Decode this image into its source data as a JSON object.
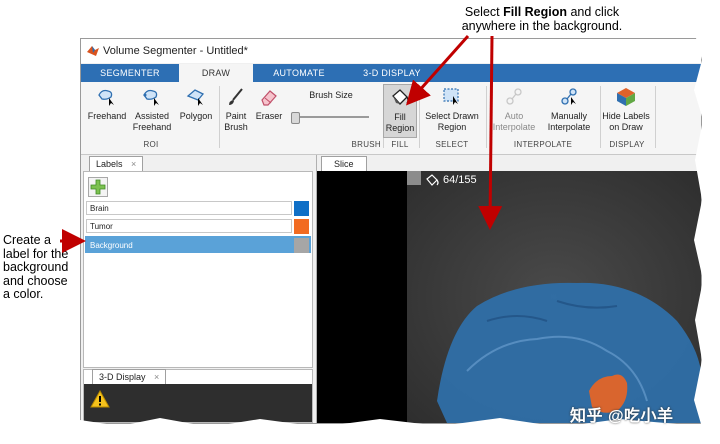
{
  "annotations": {
    "top_line1_pre": "Select ",
    "top_line1_bold": "Fill Region",
    "top_line1_post": " and click",
    "top_line2": "anywhere in the background.",
    "left_lines": [
      "Create a",
      "label for the",
      "background",
      "and choose",
      "a color."
    ]
  },
  "window": {
    "title": "Volume Segmenter - Untitled*"
  },
  "tabs": [
    {
      "label": "SEGMENTER"
    },
    {
      "label": "DRAW"
    },
    {
      "label": "AUTOMATE"
    },
    {
      "label": "3-D DISPLAY"
    }
  ],
  "ribbon": {
    "roi": {
      "freehand": "Freehand",
      "assisted_1": "Assisted",
      "assisted_2": "Freehand",
      "polygon": "Polygon",
      "group": "ROI"
    },
    "brush": {
      "paint_1": "Paint",
      "paint_2": "Brush",
      "eraser": "Eraser",
      "size_label": "Brush Size",
      "group": "BRUSH",
      "size_level": 0.0
    },
    "fill": {
      "label_1": "Fill",
      "label_2": "Region",
      "group": "FILL"
    },
    "select": {
      "label_1": "Select Drawn",
      "label_2": "Region",
      "group": "SELECT"
    },
    "interpolate": {
      "auto_1": "Auto",
      "auto_2": "Interpolate",
      "manual_1": "Manually",
      "manual_2": "Interpolate",
      "group": "INTERPOLATE"
    },
    "display": {
      "hide_1": "Hide Labels",
      "hide_2": "on Draw",
      "group": "DISPLAY"
    }
  },
  "labels_panel": {
    "tab": "Labels",
    "close": "×",
    "items": [
      {
        "name": "Brain",
        "color": "#0f6fc6"
      },
      {
        "name": "Tumor",
        "color": "#f26b21"
      },
      {
        "name": "Background",
        "color": "#a6a6a6"
      }
    ]
  },
  "slice_panel": {
    "tab": "Slice",
    "counter": "64/155"
  },
  "threed_panel": {
    "tab": "3-D Display",
    "close": "×"
  },
  "colors": {
    "tab_bar": "#2d6fb4",
    "selected_row": "#5aa2d8",
    "arrow": "#c00000",
    "brain_overlay": "#2f6fa8",
    "tumor_overlay": "#d9652e"
  },
  "watermark": "知乎 @吃小羊"
}
